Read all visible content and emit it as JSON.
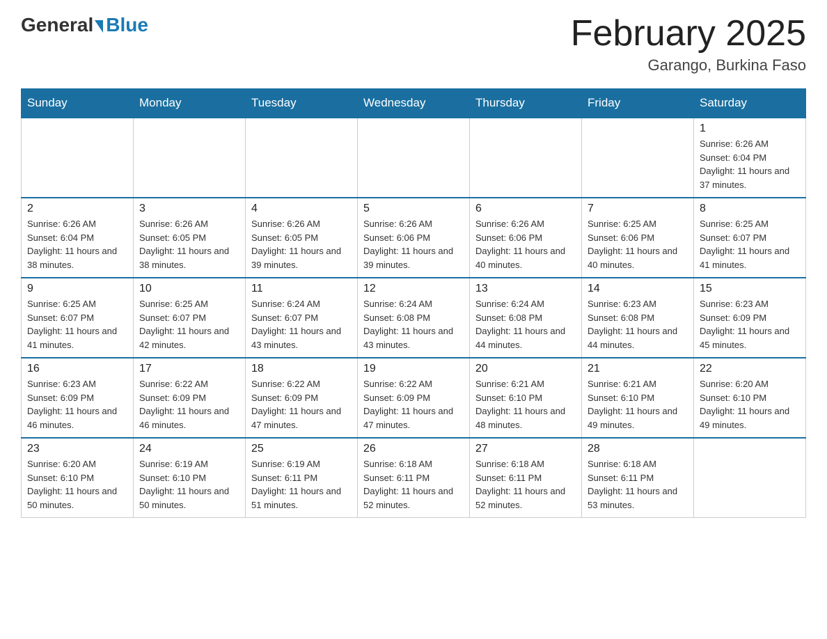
{
  "header": {
    "logo_general": "General",
    "logo_blue": "Blue",
    "month_title": "February 2025",
    "location": "Garango, Burkina Faso"
  },
  "days_of_week": [
    "Sunday",
    "Monday",
    "Tuesday",
    "Wednesday",
    "Thursday",
    "Friday",
    "Saturday"
  ],
  "weeks": [
    [
      {
        "day": "",
        "info": ""
      },
      {
        "day": "",
        "info": ""
      },
      {
        "day": "",
        "info": ""
      },
      {
        "day": "",
        "info": ""
      },
      {
        "day": "",
        "info": ""
      },
      {
        "day": "",
        "info": ""
      },
      {
        "day": "1",
        "info": "Sunrise: 6:26 AM\nSunset: 6:04 PM\nDaylight: 11 hours and 37 minutes."
      }
    ],
    [
      {
        "day": "2",
        "info": "Sunrise: 6:26 AM\nSunset: 6:04 PM\nDaylight: 11 hours and 38 minutes."
      },
      {
        "day": "3",
        "info": "Sunrise: 6:26 AM\nSunset: 6:05 PM\nDaylight: 11 hours and 38 minutes."
      },
      {
        "day": "4",
        "info": "Sunrise: 6:26 AM\nSunset: 6:05 PM\nDaylight: 11 hours and 39 minutes."
      },
      {
        "day": "5",
        "info": "Sunrise: 6:26 AM\nSunset: 6:06 PM\nDaylight: 11 hours and 39 minutes."
      },
      {
        "day": "6",
        "info": "Sunrise: 6:26 AM\nSunset: 6:06 PM\nDaylight: 11 hours and 40 minutes."
      },
      {
        "day": "7",
        "info": "Sunrise: 6:25 AM\nSunset: 6:06 PM\nDaylight: 11 hours and 40 minutes."
      },
      {
        "day": "8",
        "info": "Sunrise: 6:25 AM\nSunset: 6:07 PM\nDaylight: 11 hours and 41 minutes."
      }
    ],
    [
      {
        "day": "9",
        "info": "Sunrise: 6:25 AM\nSunset: 6:07 PM\nDaylight: 11 hours and 41 minutes."
      },
      {
        "day": "10",
        "info": "Sunrise: 6:25 AM\nSunset: 6:07 PM\nDaylight: 11 hours and 42 minutes."
      },
      {
        "day": "11",
        "info": "Sunrise: 6:24 AM\nSunset: 6:07 PM\nDaylight: 11 hours and 43 minutes."
      },
      {
        "day": "12",
        "info": "Sunrise: 6:24 AM\nSunset: 6:08 PM\nDaylight: 11 hours and 43 minutes."
      },
      {
        "day": "13",
        "info": "Sunrise: 6:24 AM\nSunset: 6:08 PM\nDaylight: 11 hours and 44 minutes."
      },
      {
        "day": "14",
        "info": "Sunrise: 6:23 AM\nSunset: 6:08 PM\nDaylight: 11 hours and 44 minutes."
      },
      {
        "day": "15",
        "info": "Sunrise: 6:23 AM\nSunset: 6:09 PM\nDaylight: 11 hours and 45 minutes."
      }
    ],
    [
      {
        "day": "16",
        "info": "Sunrise: 6:23 AM\nSunset: 6:09 PM\nDaylight: 11 hours and 46 minutes."
      },
      {
        "day": "17",
        "info": "Sunrise: 6:22 AM\nSunset: 6:09 PM\nDaylight: 11 hours and 46 minutes."
      },
      {
        "day": "18",
        "info": "Sunrise: 6:22 AM\nSunset: 6:09 PM\nDaylight: 11 hours and 47 minutes."
      },
      {
        "day": "19",
        "info": "Sunrise: 6:22 AM\nSunset: 6:09 PM\nDaylight: 11 hours and 47 minutes."
      },
      {
        "day": "20",
        "info": "Sunrise: 6:21 AM\nSunset: 6:10 PM\nDaylight: 11 hours and 48 minutes."
      },
      {
        "day": "21",
        "info": "Sunrise: 6:21 AM\nSunset: 6:10 PM\nDaylight: 11 hours and 49 minutes."
      },
      {
        "day": "22",
        "info": "Sunrise: 6:20 AM\nSunset: 6:10 PM\nDaylight: 11 hours and 49 minutes."
      }
    ],
    [
      {
        "day": "23",
        "info": "Sunrise: 6:20 AM\nSunset: 6:10 PM\nDaylight: 11 hours and 50 minutes."
      },
      {
        "day": "24",
        "info": "Sunrise: 6:19 AM\nSunset: 6:10 PM\nDaylight: 11 hours and 50 minutes."
      },
      {
        "day": "25",
        "info": "Sunrise: 6:19 AM\nSunset: 6:11 PM\nDaylight: 11 hours and 51 minutes."
      },
      {
        "day": "26",
        "info": "Sunrise: 6:18 AM\nSunset: 6:11 PM\nDaylight: 11 hours and 52 minutes."
      },
      {
        "day": "27",
        "info": "Sunrise: 6:18 AM\nSunset: 6:11 PM\nDaylight: 11 hours and 52 minutes."
      },
      {
        "day": "28",
        "info": "Sunrise: 6:18 AM\nSunset: 6:11 PM\nDaylight: 11 hours and 53 minutes."
      },
      {
        "day": "",
        "info": ""
      }
    ]
  ]
}
